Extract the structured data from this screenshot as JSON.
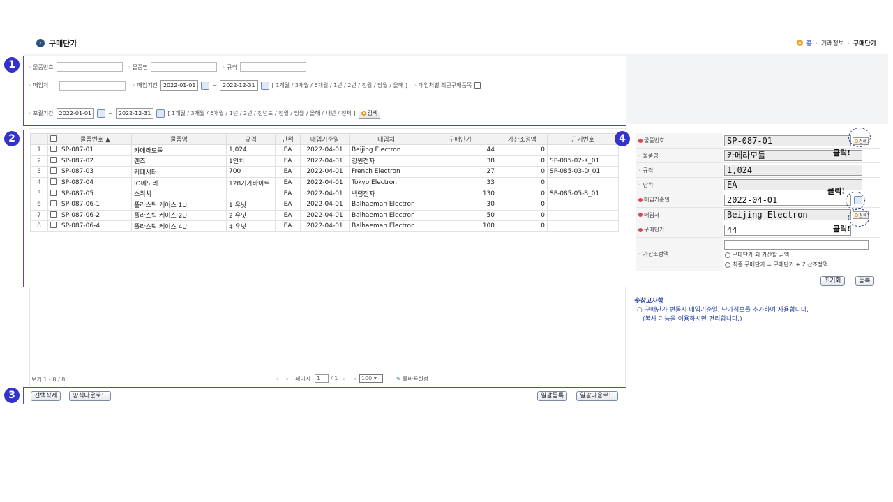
{
  "page": {
    "title": "구매단가"
  },
  "breadcrumb": {
    "home": "홈",
    "mid": "거래정보",
    "current": "구매단가"
  },
  "badges": [
    "1",
    "2",
    "3",
    "4"
  ],
  "search": {
    "item_code_label": "물품번호",
    "item_name_label": "물품명",
    "spec_label": "규격",
    "vendor_label": "매입처",
    "purchase_period_label": "매입기간",
    "purchase_from": "2022-01-01",
    "purchase_to": "2022-12-31",
    "period_links": "[ 1개월 / 3개월 / 6개월 / 1년 / 2년 / 전월 / 당월 / 올해 ]",
    "vendor_recent_label": "매입처별 최근구매품목",
    "reg_period_label": "포괄기간",
    "reg_from": "2022-01-01",
    "reg_to": "2022-12-31",
    "reg_period_links": "[ 1개월 / 3개월 / 6개월 / 1년 / 2년 / 전년도 / 전월 / 당월 / 올해 / 내년 / 전체 ]",
    "search_button": "검색",
    "tilde": "~"
  },
  "grid": {
    "columns": [
      "물품번호 ▲",
      "물품명",
      "규격",
      "단위",
      "매입기준일",
      "매입처",
      "구매단가",
      "가산조정액",
      "근거번호"
    ],
    "rows": [
      {
        "no": "1",
        "code": "SP-087-01",
        "name": "카메라모듈",
        "spec": "1,024",
        "unit": "EA",
        "date": "2022-04-01",
        "vendor": "Beijing Electron",
        "price": "44",
        "adj": "0",
        "ref": ""
      },
      {
        "no": "2",
        "code": "SP-087-02",
        "name": "렌즈",
        "spec": "1인치",
        "unit": "EA",
        "date": "2022-04-01",
        "vendor": "강원전자",
        "price": "38",
        "adj": "0",
        "ref": "SP-085-02-K_01"
      },
      {
        "no": "3",
        "code": "SP-087-03",
        "name": "커패시터",
        "spec": "700",
        "unit": "EA",
        "date": "2022-04-01",
        "vendor": "French Electron",
        "price": "27",
        "adj": "0",
        "ref": "SP-085-03-D_01"
      },
      {
        "no": "4",
        "code": "SP-087-04",
        "name": "IO메모리",
        "spec": "128기가바이트",
        "unit": "EA",
        "date": "2022-04-01",
        "vendor": "Tokyo Electron",
        "price": "33",
        "adj": "0",
        "ref": ""
      },
      {
        "no": "5",
        "code": "SP-087-05",
        "name": "스위치",
        "spec": "",
        "unit": "EA",
        "date": "2022-04-01",
        "vendor": "백령전자",
        "price": "130",
        "adj": "0",
        "ref": "SP-085-05-B_01"
      },
      {
        "no": "6",
        "code": "SP-087-06-1",
        "name": "플라스틱 케이스 1U",
        "spec": "1 유닛",
        "unit": "EA",
        "date": "2022-04-01",
        "vendor": "Balhaeman Electron",
        "price": "30",
        "adj": "0",
        "ref": ""
      },
      {
        "no": "7",
        "code": "SP-087-06-2",
        "name": "플라스틱 케이스 2U",
        "spec": "2 유닛",
        "unit": "EA",
        "date": "2022-04-01",
        "vendor": "Balhaeman Electron",
        "price": "50",
        "adj": "0",
        "ref": ""
      },
      {
        "no": "8",
        "code": "SP-087-06-4",
        "name": "플라스틱 케이스 4U",
        "spec": "4 유닛",
        "unit": "EA",
        "date": "2022-04-01",
        "vendor": "Balhaeman Electron",
        "price": "100",
        "adj": "0",
        "ref": ""
      }
    ]
  },
  "pager": {
    "view_count": "보기 1 - 8 / 8",
    "page_label": "페이지",
    "page_value": "1",
    "page_total": "/ 1",
    "page_size": "100",
    "settings_label": "줄바꿈설정"
  },
  "actions": {
    "delete_selected": "선택삭제",
    "form_download": "양식다운로드",
    "bulk_register": "일괄등록",
    "bulk_download": "일괄다운로드"
  },
  "detail": {
    "code_label": "물품번호",
    "code_value": "SP-087-01",
    "name_label": "물품명",
    "name_value": "카메라모듈",
    "spec_label": "규격",
    "spec_value": "1,024",
    "unit_label": "단위",
    "unit_value": "EA",
    "date_label": "매입기준일",
    "date_value": "2022-04-01",
    "vendor_label": "매입처",
    "vendor_value": "Beijing Electron",
    "price_label": "구매단가",
    "price_value": "44",
    "adj_label": "가산조정액",
    "adj_opt1": "구매단가 외 가산할 금액",
    "adj_opt2": "최종 구매단가 = 구매단가 + 가산조정액",
    "search_button": "검색",
    "click_note": "클릭!",
    "reset_button": "초기화",
    "register_button": "등록"
  },
  "notes": {
    "title": "※참고사항",
    "line1": "○ 구매단가 변동시 매입기준일, 단가정보를 추가하여 사용합니다.",
    "line2": "(복사 기능을 이용하시면 편리합니다.)"
  }
}
